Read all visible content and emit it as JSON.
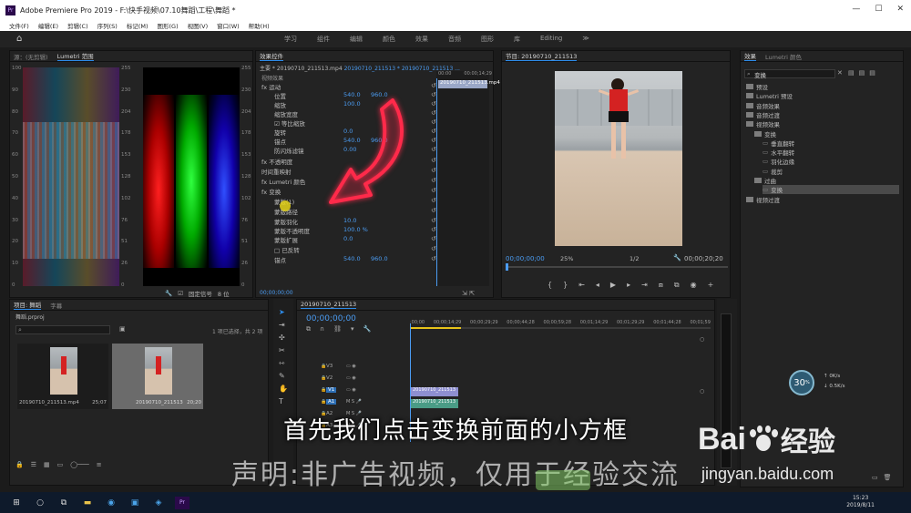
{
  "window": {
    "title": "Adobe Premiere Pro 2019 - F:\\快手视频\\07.10舞蹈\\工程\\舞蹈 *",
    "app_icon": "Pr",
    "controls": [
      "—",
      "☐",
      "✕"
    ]
  },
  "menu": [
    "文件(F)",
    "编辑(E)",
    "剪辑(C)",
    "序列(S)",
    "标记(M)",
    "图形(G)",
    "视图(V)",
    "窗口(W)",
    "帮助(H)"
  ],
  "workspaces": [
    "学习",
    "组件",
    "编辑",
    "颜色",
    "效果",
    "音频",
    "图形",
    "库",
    "Editing",
    "≫"
  ],
  "scopes": {
    "tab_source": "源：(无剪辑)",
    "tab_lumetri": "Lumetri 范围",
    "left_scale": [
      "100",
      "90",
      "80",
      "70",
      "60",
      "50",
      "40",
      "30",
      "20",
      "10",
      "0"
    ],
    "mid_scale": [
      "255",
      "230",
      "204",
      "178",
      "153",
      "128",
      "102",
      "76",
      "51",
      "26",
      "0"
    ],
    "right_scale": [
      "255",
      "230",
      "204",
      "178",
      "153",
      "128",
      "102",
      "76",
      "51",
      "26",
      "0"
    ],
    "clamp_label": "固定信号",
    "bits": "8 位"
  },
  "effect_controls": {
    "tab": "效果控件",
    "master": "主要 * 20190710_211513.mp4",
    "sequence": "20190710_211513 * 20190710_211513 ...",
    "timecodes": [
      "00:00",
      "00:00;14;29"
    ],
    "clip_name": "20190710_211513.mp4",
    "video_effects": "视频效果",
    "rows": [
      {
        "label": "fx  运动",
        "v": "",
        "v2": ""
      },
      {
        "label": "位置",
        "v": "540.0",
        "v2": "960.0"
      },
      {
        "label": "缩放",
        "v": "100.0",
        "v2": ""
      },
      {
        "label": "缩放宽度",
        "v": "",
        "v2": ""
      },
      {
        "label": "☑ 等比缩放",
        "v": "",
        "v2": ""
      },
      {
        "label": "旋转",
        "v": "0.0",
        "v2": ""
      },
      {
        "label": "锚点",
        "v": "540.0",
        "v2": "960.0"
      },
      {
        "label": "防闪烁滤镜",
        "v": "0.00",
        "v2": ""
      },
      {
        "label": "fx  不透明度",
        "v": "",
        "v2": ""
      },
      {
        "label": "时间重映射",
        "v": "",
        "v2": ""
      },
      {
        "label": "fx  Lumetri 颜色",
        "v": "",
        "v2": ""
      },
      {
        "label": "fx  变换",
        "v": "",
        "v2": ""
      },
      {
        "label": "蒙版(1)",
        "v": "",
        "v2": ""
      },
      {
        "label": "蒙版路径",
        "v": "",
        "v2": ""
      },
      {
        "label": "蒙版羽化",
        "v": "10.0",
        "v2": ""
      },
      {
        "label": "蒙版不透明度",
        "v": "100.0 %",
        "v2": ""
      },
      {
        "label": "蒙版扩展",
        "v": "0.0",
        "v2": ""
      },
      {
        "label": "□ 已反转",
        "v": "",
        "v2": ""
      },
      {
        "label": "锚点",
        "v": "540.0",
        "v2": "960.0"
      }
    ],
    "timecode_bottom": "00;00;00;00"
  },
  "program": {
    "tab": "节目: 20190710_211513",
    "timecode": "00;00;00;00",
    "zoom": "25%",
    "resolution": "1/2",
    "duration": "00;00;20;20"
  },
  "fx_panel": {
    "tab_effects": "效果",
    "tab_lumetri": "Lumetri 颜色",
    "search": "变换",
    "tree": [
      {
        "label": "预设",
        "indent": 0
      },
      {
        "label": "Lumetri 预设",
        "indent": 0
      },
      {
        "label": "音频效果",
        "indent": 0
      },
      {
        "label": "音频过渡",
        "indent": 0
      },
      {
        "label": "视频效果",
        "indent": 0
      },
      {
        "label": "变换",
        "indent": 1
      },
      {
        "label": "垂直翻转",
        "indent": 2
      },
      {
        "label": "水平翻转",
        "indent": 2
      },
      {
        "label": "羽化边缘",
        "indent": 2
      },
      {
        "label": "裁剪",
        "indent": 2
      },
      {
        "label": "过曲",
        "indent": 1
      },
      {
        "label": "变换",
        "indent": 2
      },
      {
        "label": "视频过渡",
        "indent": 0
      }
    ]
  },
  "project": {
    "tab_project": "项目: 舞蹈",
    "tab_media": "字幕",
    "file": "舞蹈.prproj",
    "count": "1 项已选择，共 2 项",
    "items": [
      {
        "name": "20190710_211513.mp4",
        "duration": "25;07"
      },
      {
        "name": "20190710_211513",
        "duration": "20;20"
      }
    ]
  },
  "timeline": {
    "tab": "20190710_211513",
    "timecode": "00;00;00;00",
    "ruler": [
      ":00;00",
      "00;00;14;29",
      "00;00;29;29",
      "00;00;44;28",
      "00;00;59;28",
      "00;01;14;29",
      "00;01;29;29",
      "00;01;44;28",
      "00;01;59"
    ],
    "tracks": [
      "V3",
      "V2",
      "V1",
      "A1",
      "A2",
      "A3"
    ],
    "v1_clip": "20190710_211513",
    "a1_clip": "20190710_211513"
  },
  "speed": {
    "value": "30",
    "unit": "%",
    "up": "0K/s",
    "down": "0.5K/s"
  },
  "subtitles": {
    "line1": "首先我们点击变换前面的小方框",
    "line2": "声明:非广告视频，仅用于经验交流"
  },
  "watermark": {
    "brand": "Bai",
    "brand2": "经验",
    "url": "jingyan.baidu.com"
  },
  "taskbar": {
    "time": "15:23",
    "date": "2019/8/11"
  },
  "colors": {
    "accent": "#2d8ceb",
    "playhead": "#4b9cf2",
    "arrow": "#ff2a4a",
    "clip": "#9aa7c7"
  }
}
